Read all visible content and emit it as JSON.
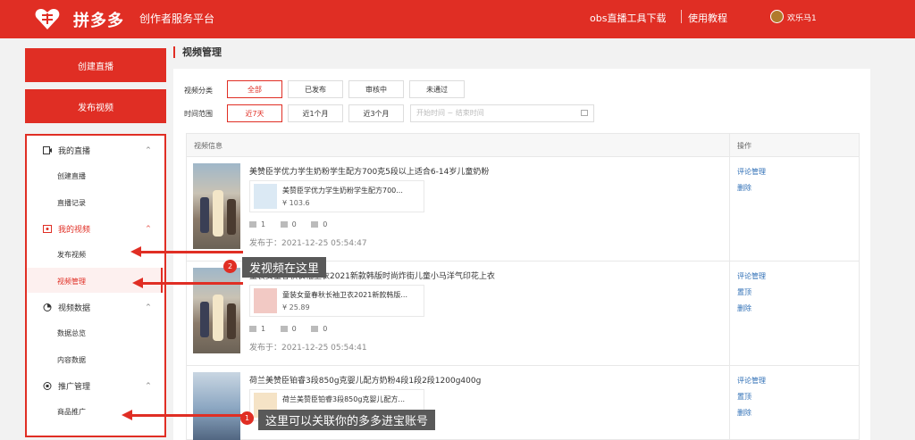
{
  "header": {
    "brand": "拼多多",
    "subtitle": "创作者服务平台",
    "link_download": "obs直播工具下载",
    "link_tutorial": "使用教程",
    "username": "欢乐马1"
  },
  "sidebar": {
    "create_live_button": "创建直播",
    "publish_video_button": "发布视频",
    "groups": [
      {
        "label": "我的直播",
        "icon": "live-icon",
        "items": [
          "创建直播",
          "直播记录"
        ]
      },
      {
        "label": "我的视频",
        "icon": "video-icon",
        "items": [
          "发布视频",
          "视频管理"
        ]
      },
      {
        "label": "视频数据",
        "icon": "chart-icon",
        "items": [
          "数据总览",
          "内容数据"
        ]
      },
      {
        "label": "推广管理",
        "icon": "promo-icon",
        "items": [
          "商品推广"
        ]
      }
    ],
    "active_item": "视频管理"
  },
  "main": {
    "title": "视频管理",
    "filters": {
      "category_label": "视频分类",
      "categories": [
        "全部",
        "已发布",
        "审核中",
        "未通过"
      ],
      "range_label": "时间范围",
      "ranges": [
        "近7天",
        "近1个月",
        "近3个月"
      ],
      "date_placeholder": "开始时间  ~  结束时间"
    },
    "table": {
      "col_info": "视频信息",
      "col_ops": "操作",
      "rows": [
        {
          "title": "美赞臣学优力学生奶粉学生配方700克5段以上适合6-14岁儿童奶粉",
          "product_name": "美赞臣学优力学生奶粉学生配方700...",
          "price": "¥ 103.6",
          "plays": "1",
          "comments": "0",
          "likes": "0",
          "published": "发布于：2021-12-25 05:54:47",
          "ops": [
            "评论管理",
            "删除"
          ]
        },
        {
          "title": "童装女童春秋长袖卫衣2021新款韩版时尚炸街儿童小马洋气印花上衣",
          "product_name": "童装女童春秋长袖卫衣2021新款韩版...",
          "price": "¥ 25.89",
          "plays": "1",
          "comments": "0",
          "likes": "0",
          "published": "发布于：2021-12-25 05:54:41",
          "ops": [
            "评论管理",
            "置顶",
            "删除"
          ]
        },
        {
          "title": "荷兰美赞臣铂睿3段850g克婴儿配方奶粉4段1段2段1200g400g",
          "product_name": "荷兰美赞臣铂睿3段850g克婴儿配方...",
          "ops": [
            "评论管理",
            "置顶",
            "删除"
          ]
        }
      ]
    }
  },
  "annotations": {
    "callout_2_num": "2",
    "callout_2_text": "发视频在这里",
    "callout_1_num": "1",
    "callout_1_text": "这里可以关联你的多多进宝账号"
  },
  "colors": {
    "brand_red": "#e02e24",
    "link_blue": "#2f6fb6",
    "callout_gray": "#595959"
  }
}
